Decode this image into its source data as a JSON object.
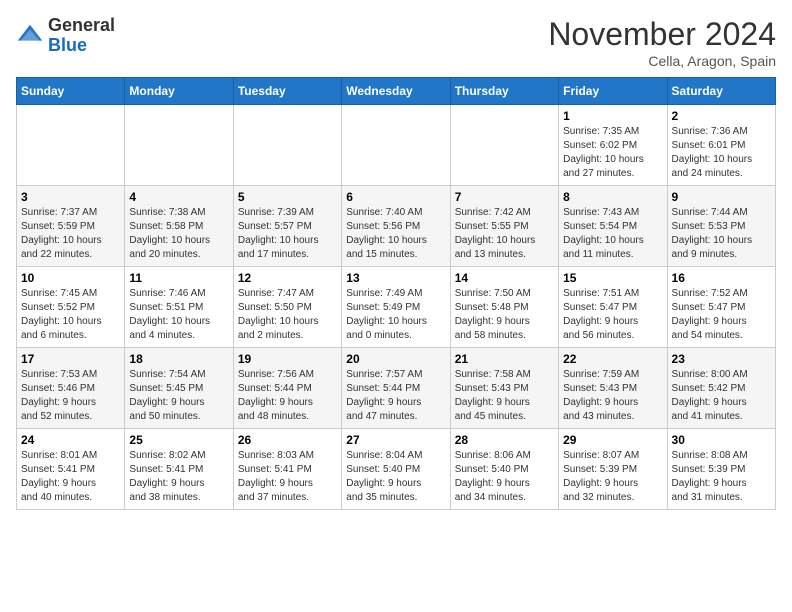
{
  "header": {
    "logo": {
      "line1": "General",
      "line2": "Blue"
    },
    "month": "November 2024",
    "location": "Cella, Aragon, Spain"
  },
  "weekdays": [
    "Sunday",
    "Monday",
    "Tuesday",
    "Wednesday",
    "Thursday",
    "Friday",
    "Saturday"
  ],
  "weeks": [
    [
      {
        "day": "",
        "info": ""
      },
      {
        "day": "",
        "info": ""
      },
      {
        "day": "",
        "info": ""
      },
      {
        "day": "",
        "info": ""
      },
      {
        "day": "",
        "info": ""
      },
      {
        "day": "1",
        "info": "Sunrise: 7:35 AM\nSunset: 6:02 PM\nDaylight: 10 hours\nand 27 minutes."
      },
      {
        "day": "2",
        "info": "Sunrise: 7:36 AM\nSunset: 6:01 PM\nDaylight: 10 hours\nand 24 minutes."
      }
    ],
    [
      {
        "day": "3",
        "info": "Sunrise: 7:37 AM\nSunset: 5:59 PM\nDaylight: 10 hours\nand 22 minutes."
      },
      {
        "day": "4",
        "info": "Sunrise: 7:38 AM\nSunset: 5:58 PM\nDaylight: 10 hours\nand 20 minutes."
      },
      {
        "day": "5",
        "info": "Sunrise: 7:39 AM\nSunset: 5:57 PM\nDaylight: 10 hours\nand 17 minutes."
      },
      {
        "day": "6",
        "info": "Sunrise: 7:40 AM\nSunset: 5:56 PM\nDaylight: 10 hours\nand 15 minutes."
      },
      {
        "day": "7",
        "info": "Sunrise: 7:42 AM\nSunset: 5:55 PM\nDaylight: 10 hours\nand 13 minutes."
      },
      {
        "day": "8",
        "info": "Sunrise: 7:43 AM\nSunset: 5:54 PM\nDaylight: 10 hours\nand 11 minutes."
      },
      {
        "day": "9",
        "info": "Sunrise: 7:44 AM\nSunset: 5:53 PM\nDaylight: 10 hours\nand 9 minutes."
      }
    ],
    [
      {
        "day": "10",
        "info": "Sunrise: 7:45 AM\nSunset: 5:52 PM\nDaylight: 10 hours\nand 6 minutes."
      },
      {
        "day": "11",
        "info": "Sunrise: 7:46 AM\nSunset: 5:51 PM\nDaylight: 10 hours\nand 4 minutes."
      },
      {
        "day": "12",
        "info": "Sunrise: 7:47 AM\nSunset: 5:50 PM\nDaylight: 10 hours\nand 2 minutes."
      },
      {
        "day": "13",
        "info": "Sunrise: 7:49 AM\nSunset: 5:49 PM\nDaylight: 10 hours\nand 0 minutes."
      },
      {
        "day": "14",
        "info": "Sunrise: 7:50 AM\nSunset: 5:48 PM\nDaylight: 9 hours\nand 58 minutes."
      },
      {
        "day": "15",
        "info": "Sunrise: 7:51 AM\nSunset: 5:47 PM\nDaylight: 9 hours\nand 56 minutes."
      },
      {
        "day": "16",
        "info": "Sunrise: 7:52 AM\nSunset: 5:47 PM\nDaylight: 9 hours\nand 54 minutes."
      }
    ],
    [
      {
        "day": "17",
        "info": "Sunrise: 7:53 AM\nSunset: 5:46 PM\nDaylight: 9 hours\nand 52 minutes."
      },
      {
        "day": "18",
        "info": "Sunrise: 7:54 AM\nSunset: 5:45 PM\nDaylight: 9 hours\nand 50 minutes."
      },
      {
        "day": "19",
        "info": "Sunrise: 7:56 AM\nSunset: 5:44 PM\nDaylight: 9 hours\nand 48 minutes."
      },
      {
        "day": "20",
        "info": "Sunrise: 7:57 AM\nSunset: 5:44 PM\nDaylight: 9 hours\nand 47 minutes."
      },
      {
        "day": "21",
        "info": "Sunrise: 7:58 AM\nSunset: 5:43 PM\nDaylight: 9 hours\nand 45 minutes."
      },
      {
        "day": "22",
        "info": "Sunrise: 7:59 AM\nSunset: 5:43 PM\nDaylight: 9 hours\nand 43 minutes."
      },
      {
        "day": "23",
        "info": "Sunrise: 8:00 AM\nSunset: 5:42 PM\nDaylight: 9 hours\nand 41 minutes."
      }
    ],
    [
      {
        "day": "24",
        "info": "Sunrise: 8:01 AM\nSunset: 5:41 PM\nDaylight: 9 hours\nand 40 minutes."
      },
      {
        "day": "25",
        "info": "Sunrise: 8:02 AM\nSunset: 5:41 PM\nDaylight: 9 hours\nand 38 minutes."
      },
      {
        "day": "26",
        "info": "Sunrise: 8:03 AM\nSunset: 5:41 PM\nDaylight: 9 hours\nand 37 minutes."
      },
      {
        "day": "27",
        "info": "Sunrise: 8:04 AM\nSunset: 5:40 PM\nDaylight: 9 hours\nand 35 minutes."
      },
      {
        "day": "28",
        "info": "Sunrise: 8:06 AM\nSunset: 5:40 PM\nDaylight: 9 hours\nand 34 minutes."
      },
      {
        "day": "29",
        "info": "Sunrise: 8:07 AM\nSunset: 5:39 PM\nDaylight: 9 hours\nand 32 minutes."
      },
      {
        "day": "30",
        "info": "Sunrise: 8:08 AM\nSunset: 5:39 PM\nDaylight: 9 hours\nand 31 minutes."
      }
    ]
  ]
}
